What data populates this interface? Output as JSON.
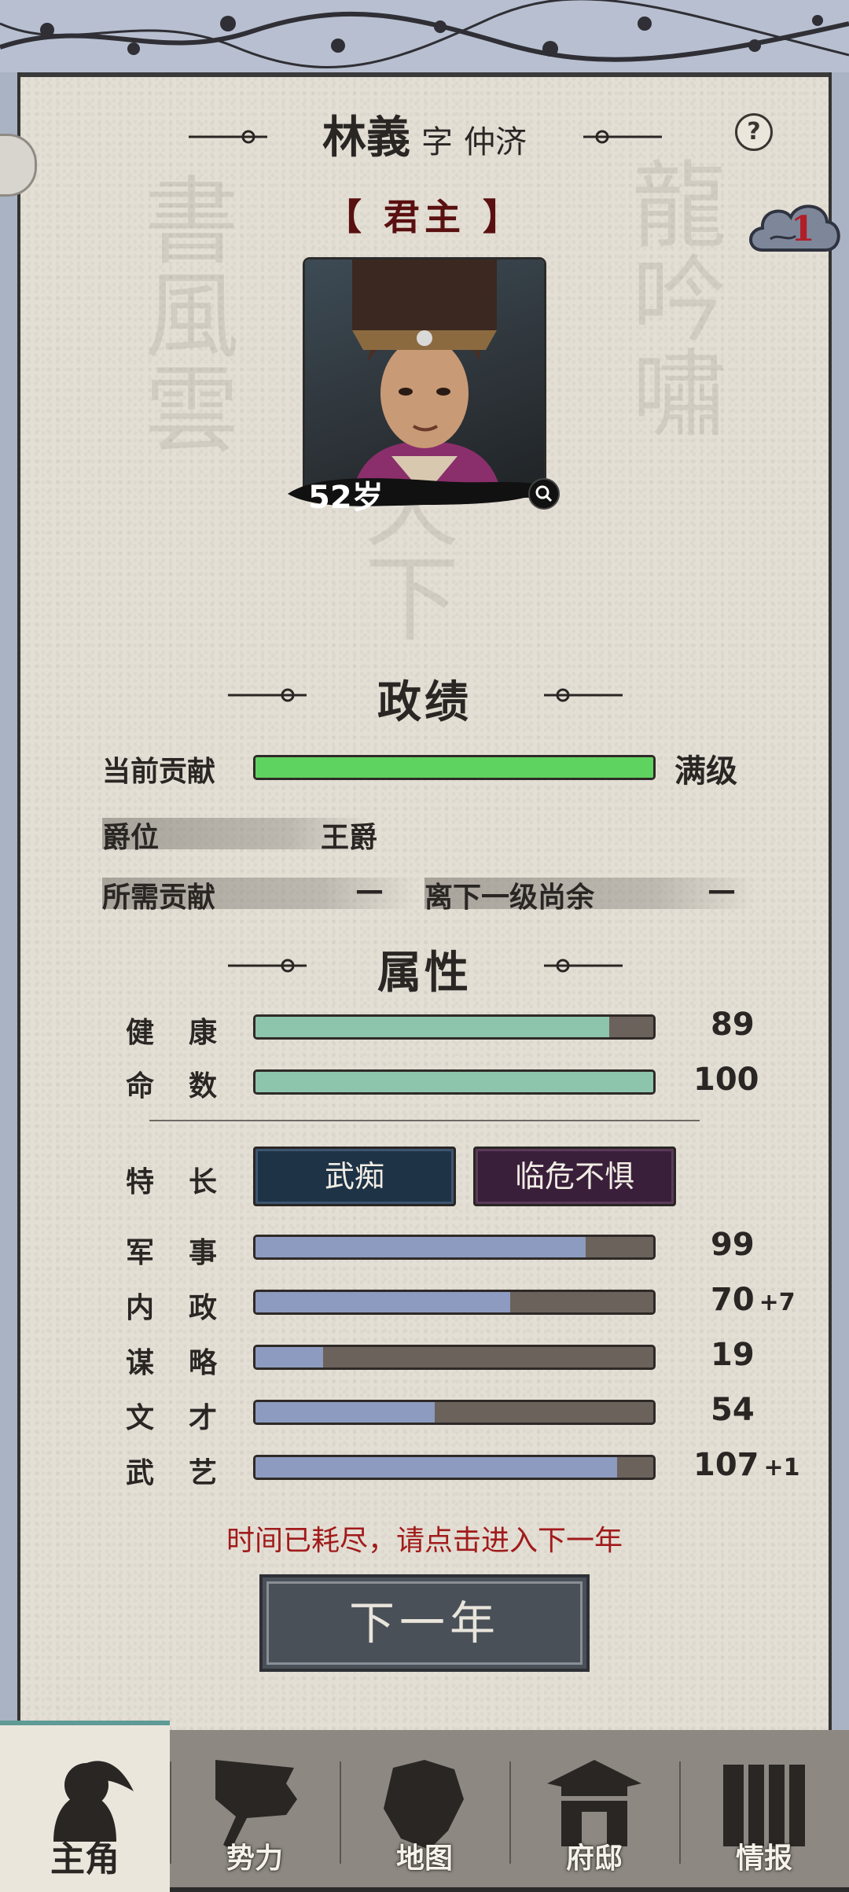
{
  "header": {
    "name": "林義",
    "courtesy_prefix": "字",
    "courtesy_name": "仲济",
    "help_label": "?",
    "notification_count": "1",
    "title_tag": "【 君主 】"
  },
  "portrait": {
    "age": "52岁"
  },
  "achievements": {
    "section_title": "政绩",
    "contribution_label": "当前贡献",
    "contribution_fill": 1.0,
    "contribution_status": "满级",
    "rank_label": "爵位",
    "rank_value": "王爵",
    "required_label": "所需贡献",
    "required_value": "—",
    "remaining_label": "离下一级尚余",
    "remaining_value": "—"
  },
  "attributes": {
    "section_title": "属性",
    "health": {
      "label": "健康",
      "value": "89",
      "fill": 0.89
    },
    "fate": {
      "label": "命数",
      "value": "100",
      "fill": 1.0
    },
    "specialty_label": "特长",
    "traits": [
      "武痴",
      "临危不惧"
    ],
    "stats": [
      {
        "label": "军事",
        "value": "99",
        "bonus": "",
        "fill": 0.83
      },
      {
        "label": "内政",
        "value": "70",
        "bonus": "+7",
        "fill": 0.64
      },
      {
        "label": "谋略",
        "value": "19",
        "bonus": "",
        "fill": 0.17
      },
      {
        "label": "文才",
        "value": "54",
        "bonus": "",
        "fill": 0.45
      },
      {
        "label": "武艺",
        "value": "107",
        "bonus": "+1",
        "fill": 0.91
      }
    ]
  },
  "notice": "时间已耗尽，请点击进入下一年",
  "next_year_button": "下一年",
  "nav": {
    "items": [
      {
        "label": "主角",
        "icon": "general-icon",
        "active": true
      },
      {
        "label": "势力",
        "icon": "banner-icon",
        "active": false
      },
      {
        "label": "地图",
        "icon": "map-icon",
        "active": false
      },
      {
        "label": "府邸",
        "icon": "mansion-icon",
        "active": false
      },
      {
        "label": "情报",
        "icon": "scroll-icon",
        "active": false
      }
    ]
  },
  "colors": {
    "paper": "#e4dfd5",
    "ink": "#2a2624",
    "contribution_bar": "#5fd35f",
    "health_bar": "#8cc4ac",
    "stat_bar": "#8c9bbf",
    "notice": "#a11b1b",
    "trait_blue": "#1f3346",
    "trait_purple": "#3a1f3a"
  }
}
